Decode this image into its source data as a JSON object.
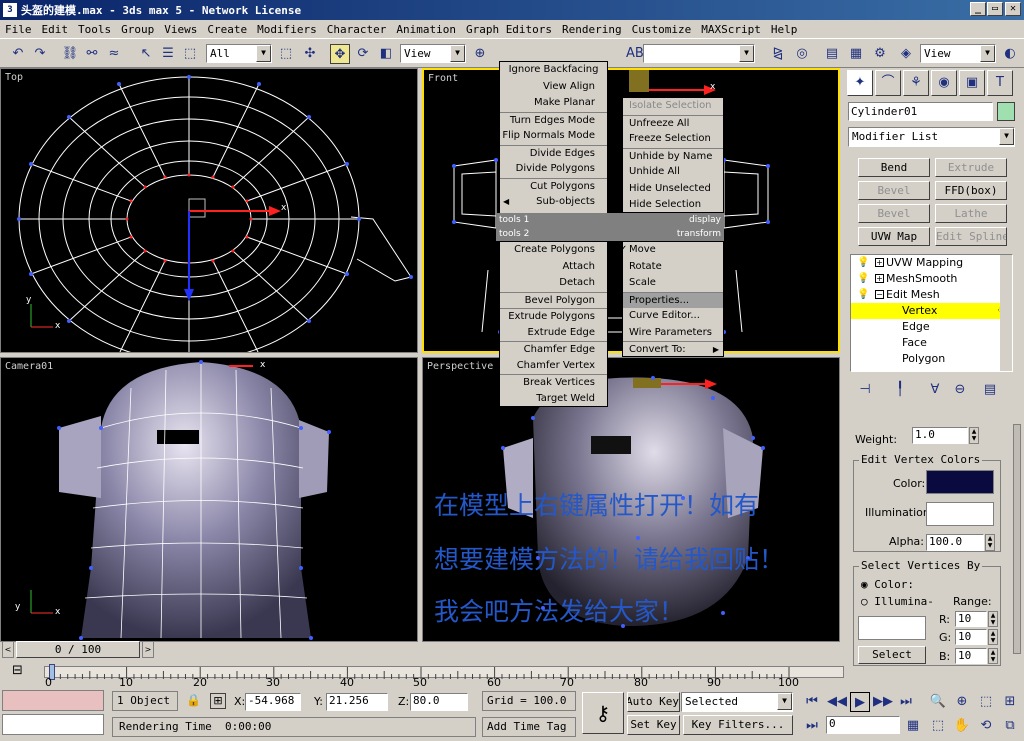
{
  "window": {
    "title": "头盔的建模.max - 3ds max 5 - Network License"
  },
  "menu": [
    "File",
    "Edit",
    "Tools",
    "Group",
    "Views",
    "Create",
    "Modifiers",
    "Character",
    "Animation",
    "Graph Editors",
    "Rendering",
    "Customize",
    "MAXScript",
    "Help"
  ],
  "toolbar": {
    "selection_filter": "All",
    "ref_coord": "View",
    "named_selection": "",
    "view_right": "View"
  },
  "viewports": {
    "top": "Top",
    "front": "Front",
    "camera": "Camera01",
    "perspective": "Perspective",
    "axis_x": "x",
    "axis_y": "y",
    "axis_z": "z"
  },
  "quad_menu": {
    "tools1_items": [
      "Ignore Backfacing",
      "View Align",
      "Make Planar",
      "Turn Edges Mode",
      "Flip Normals Mode",
      "Divide Edges",
      "Divide Polygons",
      "Cut Polygons",
      "Sub-objects"
    ],
    "display_items": [
      "Isolate Selection",
      "Unfreeze All",
      "Freeze Selection",
      "Unhide by Name",
      "Unhide All",
      "Hide Unselected",
      "Hide Selection"
    ],
    "tools1_title": "tools 1",
    "display_title": "display",
    "tools2_title": "tools 2",
    "transform_title": "transform",
    "tools2_items": [
      "Create Polygons",
      "Attach",
      "Detach",
      "Bevel Polygon",
      "Extrude Polygons",
      "Extrude Edge",
      "Chamfer Edge",
      "Chamfer Vertex",
      "Break Vertices",
      "Target Weld"
    ],
    "transform_items": [
      "Move",
      "Rotate",
      "Scale",
      "Properties...",
      "Curve Editor...",
      "Wire Parameters",
      "Convert To:"
    ]
  },
  "command_panel": {
    "object_name": "Cylinder01",
    "object_color": "#a0e0b0",
    "modifier_list": "Modifier List",
    "buttons": [
      "Bend",
      "Extrude",
      "Bevel",
      "FFD(box)",
      "Bevel Profile",
      "Lathe",
      "UVW Map",
      "Edit Spline"
    ],
    "stack": [
      "UVW Mapping",
      "MeshSmooth",
      "Edit Mesh",
      "Vertex",
      "Edge",
      "Face",
      "Polygon"
    ],
    "weight_label": "Weight:",
    "weight": "1.0",
    "vertex_colors_title": "Edit Vertex Colors",
    "color_label": "Color:",
    "color_value": "#0a0a40",
    "illumination_label": "Illumination:",
    "alpha_label": "Alpha:",
    "alpha": "100.0",
    "select_by_title": "Select Vertices By",
    "radio_color": "Color:",
    "radio_illum": "Illumina-",
    "range_label": "Range:",
    "r_label": "R:",
    "r": "10",
    "g_label": "G:",
    "g": "10",
    "b_label": "B:",
    "b": "10",
    "select_button": "Select"
  },
  "timeline": {
    "slider": "0 / 100",
    "ticks": [
      "0",
      "10",
      "20",
      "30",
      "40",
      "50",
      "60",
      "70",
      "80",
      "90",
      "100"
    ]
  },
  "status": {
    "selection": "1 Object",
    "x_label": "X:",
    "x": "-54.968",
    "y_label": "Y:",
    "y": "21.256",
    "z_label": "Z:",
    "z": "80.0",
    "grid": "Grid = 100.0",
    "rendering": "Rendering Time  0:00:00",
    "add_time_tag": "Add Time Tag",
    "auto_key": "Auto Key",
    "set_key": "Set Key",
    "selected": "Selected",
    "key_filters": "Key Filters...",
    "frame": "0"
  },
  "overlay_text": [
    "在模型上右键属性打开！如有",
    "想要建模方法的！请给我回贴！",
    "我会吧方法发给大家！"
  ]
}
